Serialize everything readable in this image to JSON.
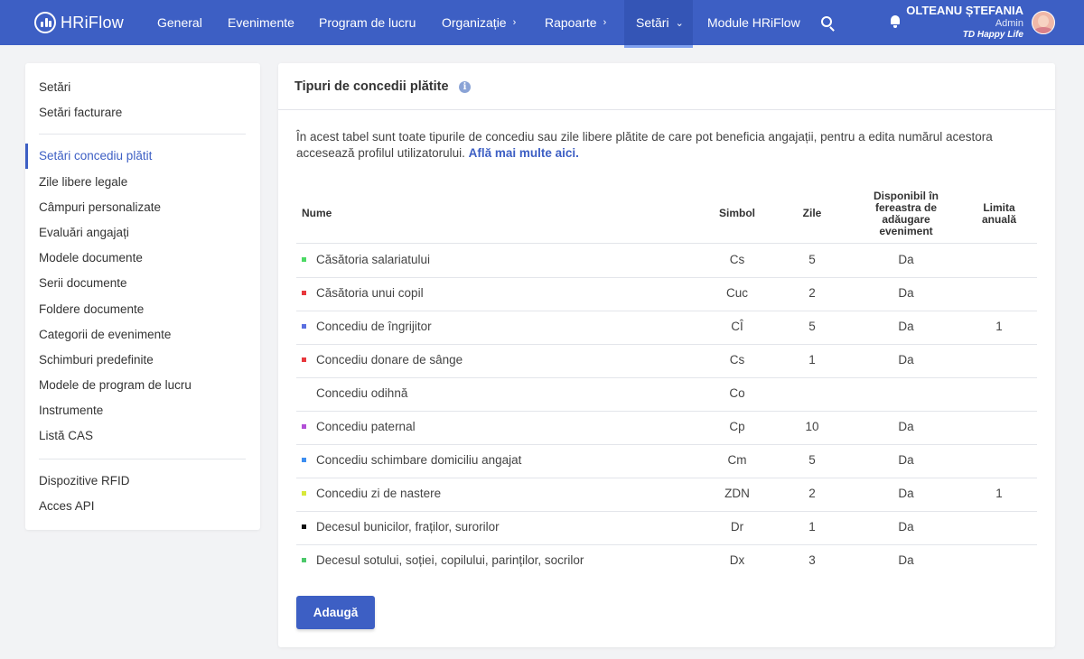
{
  "brand": {
    "logo_text": "HRiFlow"
  },
  "nav": {
    "items": [
      {
        "label": "General"
      },
      {
        "label": "Evenimente"
      },
      {
        "label": "Program de lucru"
      },
      {
        "label": "Organizație"
      },
      {
        "label": "Rapoarte"
      },
      {
        "label": "Setări"
      },
      {
        "label": "Module HRiFlow"
      }
    ],
    "chevron_right": "›",
    "chevron_down": "⌄"
  },
  "user": {
    "name": "OLTEANU ȘTEFANIA",
    "role": "Admin",
    "company": "TD Happy Life"
  },
  "sidebar": {
    "group1": [
      "Setări",
      "Setări facturare"
    ],
    "group2": [
      "Setări concediu plătit",
      "Zile libere legale",
      "Câmpuri personalizate",
      "Evaluări angajați",
      "Modele documente",
      "Serii documente",
      "Foldere documente",
      "Categorii de evenimente",
      "Schimburi predefinite",
      "Modele de program de lucru",
      "Instrumente",
      "Listă CAS"
    ],
    "group3": [
      "Dispozitive RFID",
      "Acces API"
    ],
    "active": "Setări concediu plătit"
  },
  "card": {
    "title": "Tipuri de concedii plătite",
    "info_glyph": "i",
    "description": "În acest tabel sunt toate tipurile de concediu sau zile libere plătite de care pot beneficia angajații, pentru a edita numărul acestora accesează profilul utilizatorului.",
    "learn_more": "Află mai multe aici."
  },
  "table": {
    "headers": {
      "name": "Nume",
      "symbol": "Simbol",
      "days": "Zile",
      "available_l1": "Disponibil în",
      "available_l2": "fereastra de",
      "available_l3": "adăugare",
      "available_l4": "eveniment",
      "limit_l1": "Limita",
      "limit_l2": "anuală"
    },
    "rows": [
      {
        "name": "Căsătoria salariatului",
        "symbol": "Cs",
        "days": "5",
        "available": "Da",
        "limit": "",
        "color": "#4cd964"
      },
      {
        "name": "Căsătoria unui copil",
        "symbol": "Cuc",
        "days": "2",
        "available": "Da",
        "limit": "",
        "color": "#e8383d"
      },
      {
        "name": "Concediu de îngrijitor",
        "symbol": "CÎ",
        "days": "5",
        "available": "Da",
        "limit": "1",
        "color": "#5a6fe0"
      },
      {
        "name": "Concediu donare de sânge",
        "symbol": "Cs",
        "days": "1",
        "available": "Da",
        "limit": "",
        "color": "#e8383d"
      },
      {
        "name": "Concediu odihnă",
        "symbol": "Co",
        "days": "",
        "available": "",
        "limit": "",
        "color": ""
      },
      {
        "name": "Concediu paternal",
        "symbol": "Cp",
        "days": "10",
        "available": "Da",
        "limit": "",
        "color": "#b24fd6"
      },
      {
        "name": "Concediu schimbare domiciliu angajat",
        "symbol": "Cm",
        "days": "5",
        "available": "Da",
        "limit": "",
        "color": "#3d8ef0"
      },
      {
        "name": "Concediu zi de nastere",
        "symbol": "ZDN",
        "days": "2",
        "available": "Da",
        "limit": "1",
        "color": "#d8e83a"
      },
      {
        "name": "Decesul bunicilor, fraților, surorilor",
        "symbol": "Dr",
        "days": "1",
        "available": "Da",
        "limit": "",
        "color": "#111111"
      },
      {
        "name": "Decesul sotului, soției, copilului, parinților, socrilor",
        "symbol": "Dx",
        "days": "3",
        "available": "Da",
        "limit": "",
        "color": "#4cc86a"
      }
    ]
  },
  "actions": {
    "add_label": "Adaugă"
  },
  "colors": {
    "primary": "#3d5fc4",
    "background": "#f2f3f5"
  }
}
